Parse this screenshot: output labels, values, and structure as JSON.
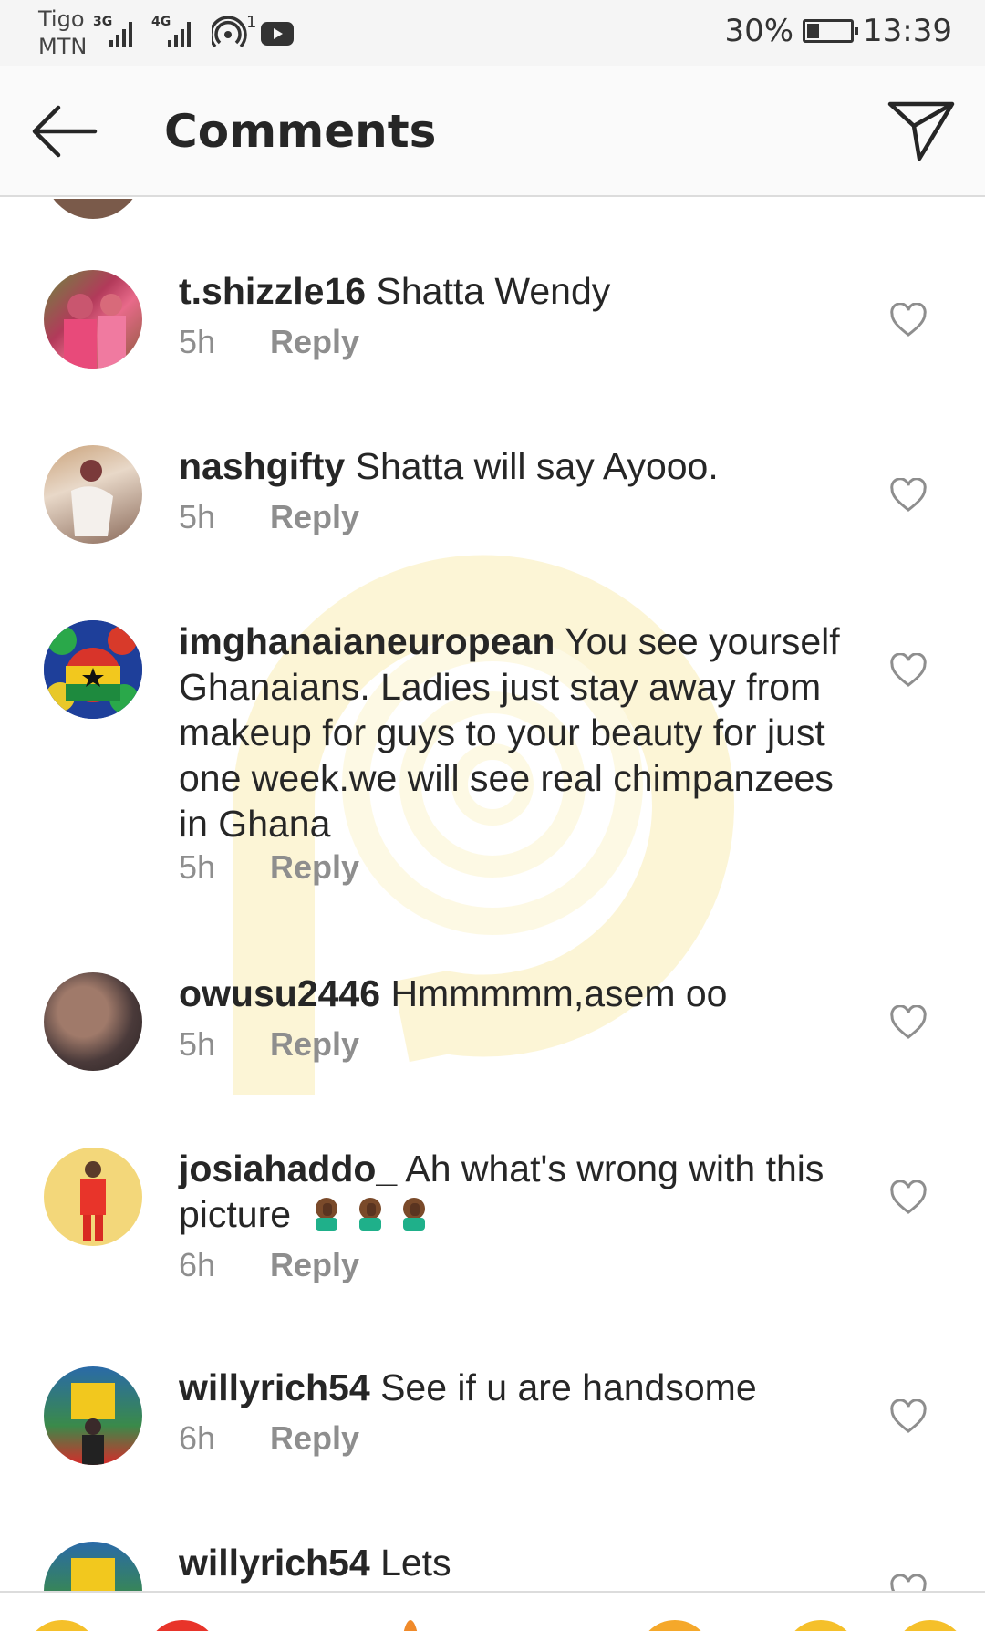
{
  "status_bar": {
    "carrier_line1": "Tigo",
    "carrier_line2": "MTN",
    "sim1_network": "3G",
    "sim2_network": "4G",
    "hotspot_count": "1",
    "battery": "30%",
    "time": "13:39"
  },
  "header": {
    "title": "Comments"
  },
  "comments": [
    {
      "username": "t.shizzle16",
      "text": "Shatta Wendy",
      "time": "5h",
      "reply": "Reply"
    },
    {
      "username": "nashgifty",
      "text": "Shatta will say Ayooo.",
      "time": "5h",
      "reply": "Reply"
    },
    {
      "username": "imghanaianeuropean",
      "text": "You see yourself Ghanaians. Ladies just stay away from makeup for guys to your beauty for just one week.we will see real chimpanzees in Ghana",
      "time": "5h",
      "reply": "Reply"
    },
    {
      "username": "owusu2446",
      "text": "Hmmmmm,asem oo",
      "time": "5h",
      "reply": "Reply"
    },
    {
      "username": "josiahaddo_",
      "text": "Ah what's wrong with this picture",
      "time": "6h",
      "reply": "Reply"
    },
    {
      "username": "willyrich54",
      "text": "See if u are handsome",
      "time": "6h",
      "reply": "Reply"
    },
    {
      "username": "willyrich54",
      "text": "Lets",
      "time": "",
      "reply": ""
    }
  ],
  "colors": {
    "text": "#262626",
    "meta": "#8e8e8e",
    "header_bg": "#fafafa",
    "status_bg": "#f5f5f5"
  }
}
